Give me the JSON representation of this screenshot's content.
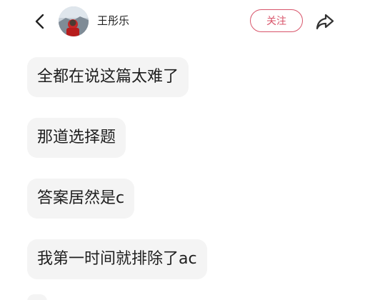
{
  "header": {
    "username": "王彤乐",
    "follow_label": "关注"
  },
  "icons": {
    "back": "chevron-left-icon",
    "share": "share-arrow-icon"
  },
  "colors": {
    "accent": "#d8546a",
    "bubble_bg": "#f4f4f4",
    "text": "#1f1f1f"
  },
  "messages": [
    "全都在说这篇太难了",
    "那道选择题",
    "答案居然是c",
    "我第一时间就排除了ac"
  ]
}
